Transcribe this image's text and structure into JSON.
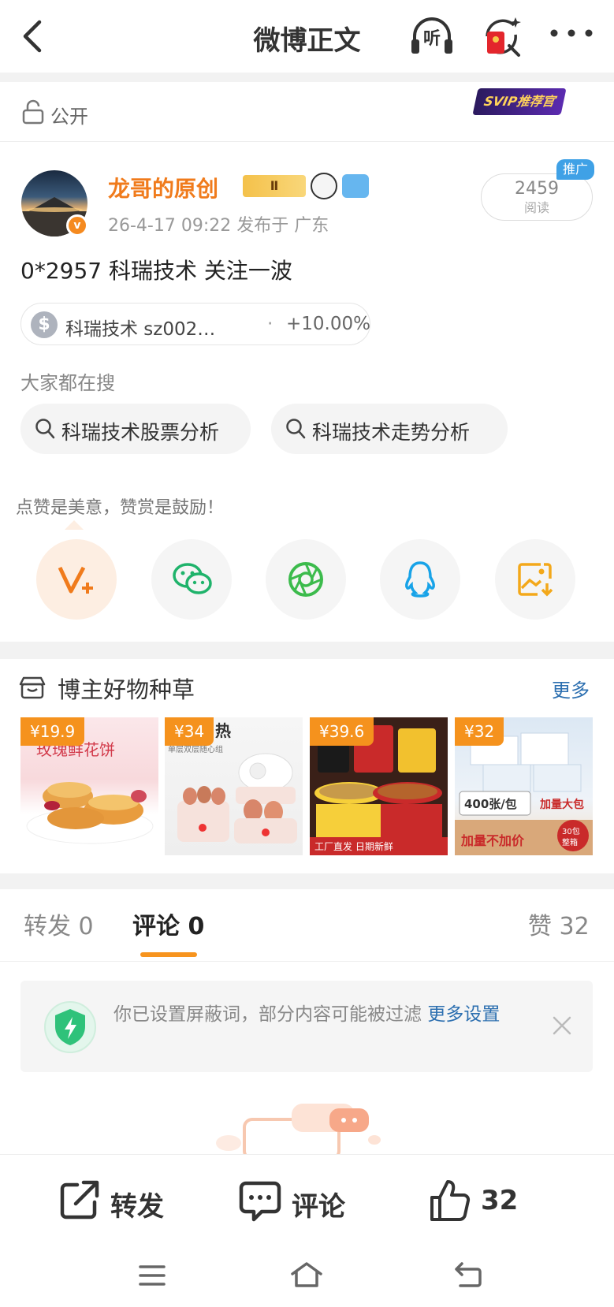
{
  "nav": {
    "title": "微博正文",
    "listen_label": "听"
  },
  "visibility": {
    "label": "公开",
    "svip_badge": "SVIP推荐官"
  },
  "author": {
    "name": "龙哥的原创",
    "vip_level": "Ⅱ",
    "meta": "26-4-17 09:22  发布于 广东",
    "reads_count": "2459",
    "reads_label": "阅读",
    "promo_tag": "推广"
  },
  "post": {
    "text": "0*2957 科瑞技术 关注一波",
    "stock": {
      "name": "科瑞技术 sz002…",
      "separator": "·",
      "change": "+10.00%"
    }
  },
  "search": {
    "label": "大家都在搜",
    "pills": [
      "科瑞技术股票分析",
      "科瑞技术走势分析"
    ]
  },
  "reward": {
    "tip": "点赞是美意，赞赏是鼓励！"
  },
  "goods": {
    "title": "博主好物种草",
    "more": "更多",
    "items": [
      {
        "price": "¥19.9"
      },
      {
        "price": "¥34"
      },
      {
        "price": "¥39.6"
      },
      {
        "price": "¥32"
      }
    ]
  },
  "tabs": {
    "repost": "转发 0",
    "comment": "评论 0",
    "like": "赞 32"
  },
  "notice": {
    "text": "你已设置屏蔽词，部分内容可能被过滤 ",
    "link": "更多设置"
  },
  "bottom_bar": {
    "repost": "转发",
    "comment": "评论",
    "like_count": "32"
  },
  "colors": {
    "accent": "#f7941e",
    "author_name": "#f07b1c",
    "link": "#2c6fb0"
  }
}
